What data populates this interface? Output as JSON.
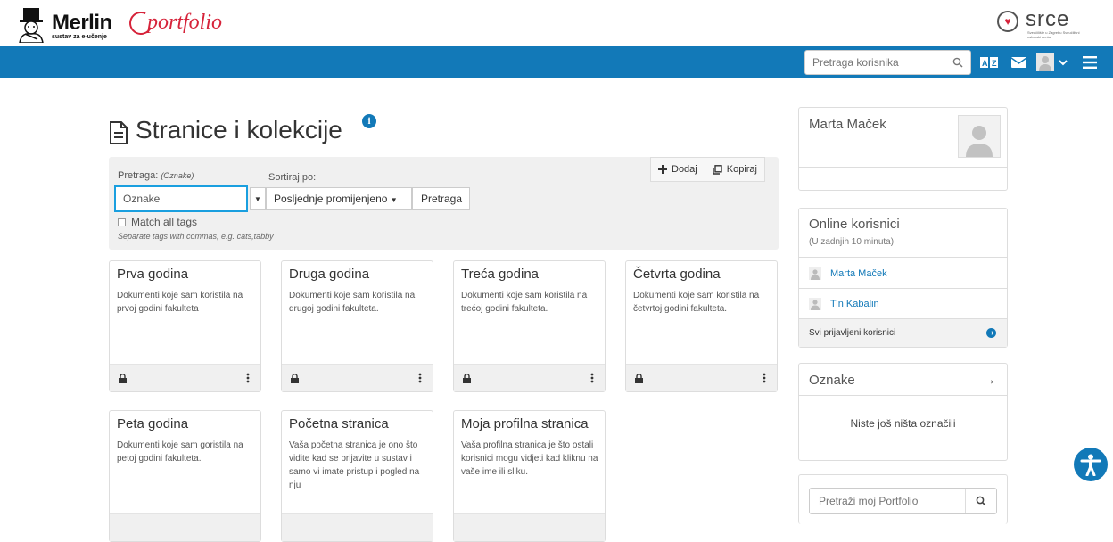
{
  "header": {
    "merlin_title": "Merlin",
    "merlin_subtitle": "sustav za e-učenje",
    "eportfolio_text": "portfolio",
    "srce_text": "srce",
    "srce_subtitle": "Sveučilište u Zagrebu Sveučilišni računski centar"
  },
  "navbar": {
    "search_placeholder": "Pretraga korisnika",
    "color": "#1279b8"
  },
  "page": {
    "title": "Stranice i kolekcije"
  },
  "filter": {
    "search_label": "Pretraga:",
    "search_label_hint": "(Oznake)",
    "sort_label": "Sortiraj po:",
    "tags_value": "Oznake",
    "sort_value": "Posljednje promijenjeno",
    "search_button": "Pretraga",
    "match_all_label": "Match all tags",
    "match_all_hint": "Separate tags with commas, e.g. cats,tabby",
    "add_button": "Dodaj",
    "copy_button": "Kopiraj"
  },
  "cards": [
    {
      "title": "Prva godina",
      "desc": "Dokumenti koje sam koristila na prvoj godini fakulteta"
    },
    {
      "title": "Druga godina",
      "desc": "Dokumenti koje sam koristila na drugoj godini fakulteta."
    },
    {
      "title": "Treća godina",
      "desc": "Dokumenti koje sam koristila na trećoj godini fakulteta."
    },
    {
      "title": "Četvrta godina",
      "desc": "Dokumenti koje sam koristila na četvrtoj godini fakulteta."
    },
    {
      "title": "Peta godina",
      "desc": "Dokumenti koje sam goristila na petoj godini fakulteta."
    },
    {
      "title": "Početna stranica",
      "desc": "Vaša početna stranica je ono što vidite kad se prijavite u sustav i samo vi imate pristup i pogled na nju"
    },
    {
      "title": "Moja profilna stranica",
      "desc": "Vaša profilna stranica je što ostali korisnici mogu vidjeti kad kliknu na vaše ime ili sliku."
    }
  ],
  "sidebar": {
    "profile_name": "Marta Maček",
    "online_title": "Online korisnici",
    "online_subtitle": "(U zadnjih 10 minuta)",
    "online_users": [
      "Marta Maček",
      "Tin Kabalin"
    ],
    "online_all": "Svi prijavljeni korisnici",
    "tags_title": "Oznake",
    "tags_empty": "Niste još ništa označili",
    "portfolio_search_placeholder": "Pretraži moj Portfolio"
  }
}
